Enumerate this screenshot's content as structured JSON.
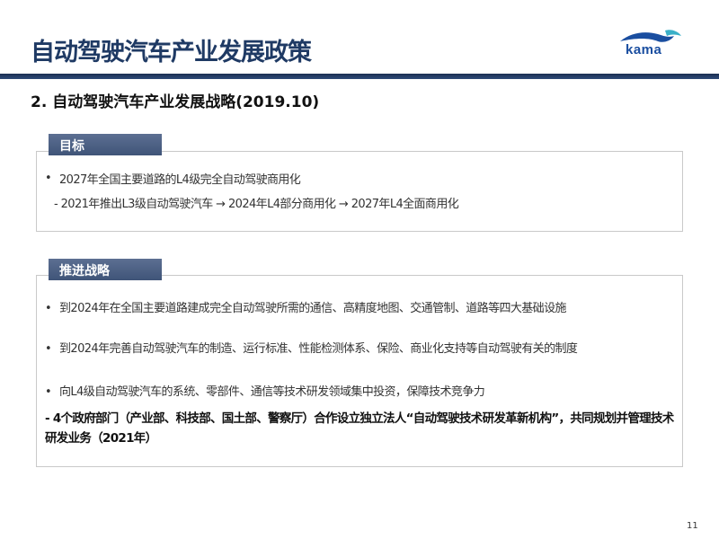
{
  "header": {
    "title": "自动驾驶汽车产业发展政策",
    "logo_text": "kama"
  },
  "subtitle": "2. 自动驾驶汽车产业发展战略(2019.10)",
  "goal_section": {
    "tab_label": "目标",
    "bullet": "•",
    "line1": "2027年全国主要道路的L4级完全自动驾驶商用化",
    "line2": "- 2021年推出L3级自动驾驶汽车 → 2024年L4部分商用化 → 2027年L4全面商用化"
  },
  "strategy_section": {
    "tab_label": "推进战略",
    "bullet": "•",
    "item1": "到2024年在全国主要道路建成完全自动驾驶所需的通信、高精度地图、交通管制、道路等四大基础设施",
    "item2": "到2024年完善自动驾驶汽车的制造、运行标准、性能检测体系、保险、商业化支持等自动驾驶有关的制度",
    "item3": "向L4级自动驾驶汽车的系统、零部件、通信等技术研发领域集中投资，保障技术竞争力",
    "item4": "- 4个政府部门（产业部、科技部、国土部、警察厅）合作设立独立法人“自动驾驶技术研发革新机构”，共同规划并管理技术研发业务（2021年）"
  },
  "footer": {
    "page_number": "11"
  },
  "colors": {
    "title": "#1f3a64",
    "rule": "#1b2f52",
    "tab": "#4a5e83",
    "logo": "#1a4ea0"
  }
}
